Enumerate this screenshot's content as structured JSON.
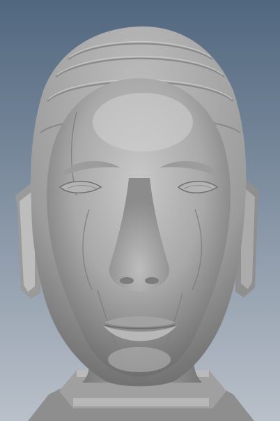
{
  "viewport": {
    "background_top": "#51677F",
    "background_bottom": "#B9C0C9",
    "model_color": "#A9A9A9",
    "model_highlight": "#C8C8C8",
    "model_shadow": "#6F6F6F",
    "subject": "sculpted-head-icon"
  }
}
